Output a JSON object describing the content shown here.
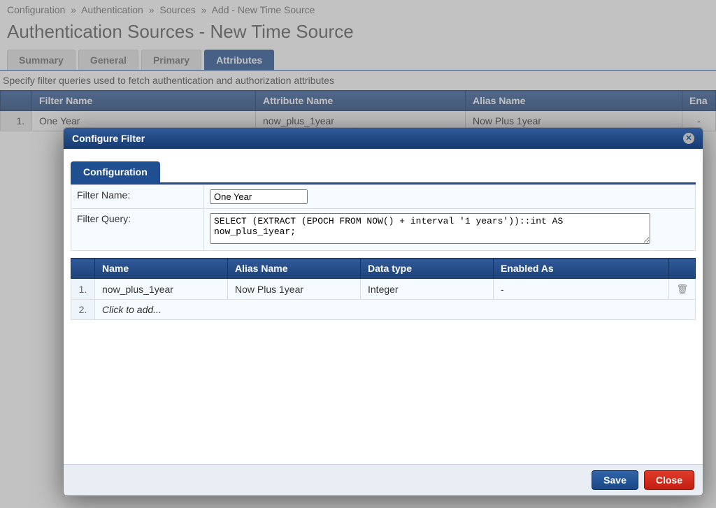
{
  "breadcrumb": {
    "items": [
      "Configuration",
      "Authentication",
      "Sources",
      "Add - New Time Source"
    ],
    "sep": "»"
  },
  "page_title": "Authentication Sources - New Time Source",
  "tabs": {
    "summary": "Summary",
    "general": "General",
    "primary": "Primary",
    "attributes": "Attributes"
  },
  "description": "Specify filter queries used to fetch authentication and authorization attributes",
  "outer_table": {
    "headers": {
      "num": "",
      "filter_name": "Filter Name",
      "attribute_name": "Attribute Name",
      "alias_name": "Alias Name",
      "enabled_as": "Ena"
    },
    "rows": [
      {
        "num": "1.",
        "filter_name": "One Year",
        "attribute_name": "now_plus_1year",
        "alias_name": "Now Plus 1year",
        "enabled_as": "-"
      }
    ]
  },
  "modal": {
    "title": "Configure Filter",
    "close_glyph": "✕",
    "inner_tab": "Configuration",
    "form": {
      "filter_name_label": "Filter Name:",
      "filter_name_value": "One Year",
      "filter_query_label": "Filter Query:",
      "filter_query_value": "SELECT (EXTRACT (EPOCH FROM NOW() + interval '1 years'))::int AS now_plus_1year;"
    },
    "attrs_table": {
      "headers": {
        "num": "",
        "name": "Name",
        "alias": "Alias Name",
        "dtype": "Data type",
        "enabled": "Enabled As",
        "actions": ""
      },
      "rows": [
        {
          "num": "1.",
          "name": "now_plus_1year",
          "alias": "Now Plus 1year",
          "dtype": "Integer",
          "enabled": "-"
        }
      ],
      "add_row_num": "2.",
      "add_placeholder": "Click to add..."
    },
    "buttons": {
      "save": "Save",
      "close": "Close"
    }
  },
  "icons": {
    "trash": "🗑"
  }
}
